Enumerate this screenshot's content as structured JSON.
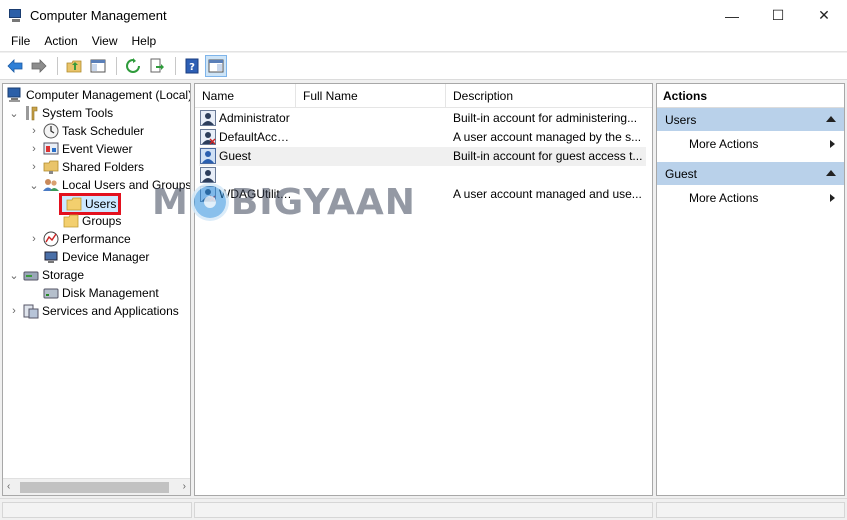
{
  "window": {
    "title": "Computer Management",
    "controls": {
      "minimize": "—",
      "maximize": "☐",
      "close": "✕"
    }
  },
  "menu": [
    "File",
    "Action",
    "View",
    "Help"
  ],
  "toolbar": {
    "buttons": [
      "back-icon",
      "forward-icon",
      "up-folder-icon",
      "show-hide-tree-icon",
      "refresh-icon",
      "export-list-icon",
      "help-icon",
      "show-hide-action-pane-icon"
    ]
  },
  "tree": {
    "root": "Computer Management (Local)",
    "system_tools": "System Tools",
    "task_scheduler": "Task Scheduler",
    "event_viewer": "Event Viewer",
    "shared_folders": "Shared Folders",
    "local_users_groups": "Local Users and Groups",
    "users": "Users",
    "groups": "Groups",
    "performance": "Performance",
    "device_manager": "Device Manager",
    "storage": "Storage",
    "disk_management": "Disk Management",
    "services_apps": "Services and Applications",
    "expander_open": "⌄",
    "expander_closed": "›",
    "scroll_left": "‹",
    "scroll_right": "›"
  },
  "list": {
    "columns": {
      "name": "Name",
      "full_name": "Full Name",
      "description": "Description"
    },
    "rows": [
      {
        "name": "Administrator",
        "full_name": "",
        "description": "Built-in account for administering..."
      },
      {
        "name": "DefaultAcco...",
        "full_name": "",
        "description": "A user account managed by the s..."
      },
      {
        "name": "Guest",
        "full_name": "",
        "description": "Built-in account for guest access t..."
      },
      {
        "name": "",
        "full_name": "",
        "description": ""
      },
      {
        "name": "WDAGUtility...",
        "full_name": "",
        "description": "A user account managed and use..."
      }
    ]
  },
  "watermark": {
    "m": "M",
    "rest": "BIGYAAN"
  },
  "actions": {
    "title": "Actions",
    "sections": [
      {
        "label": "Users",
        "item": "More Actions"
      },
      {
        "label": "Guest",
        "item": "More Actions"
      }
    ]
  }
}
